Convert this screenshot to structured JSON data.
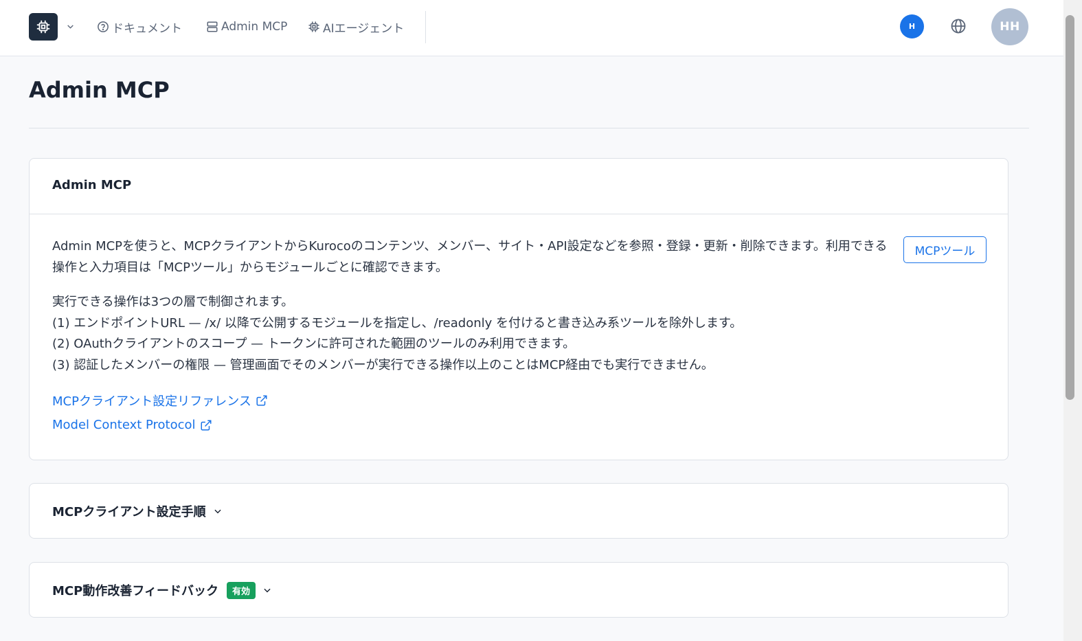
{
  "header": {
    "nav": [
      {
        "label": "ドキュメント",
        "icon": "help-circle-icon"
      },
      {
        "label": "Admin MCP",
        "icon": "server-icon"
      },
      {
        "label": "AIエージェント",
        "icon": "cpu-icon"
      }
    ],
    "user_initial": "H",
    "avatar_initials": "HH"
  },
  "page": {
    "title": "Admin MCP"
  },
  "intro_card": {
    "heading": "Admin MCP",
    "description": "Admin MCPを使うと、MCPクライアントからKurocoのコンテンツ、メンバー、サイト・API設定などを参照・登録・更新・削除できます。利用できる操作と入力項目は「MCPツール」からモジュールごとに確認できます。",
    "tool_button": "MCPツール",
    "layers": [
      "実行できる操作は3つの層で制御されます。",
      "(1) エンドポイントURL — /x/ 以降で公開するモジュールを指定し、/readonly を付けると書き込み系ツールを除外します。",
      "(2) OAuthクライアントのスコープ — トークンに許可された範囲のツールのみ利用できます。",
      "(3) 認証したメンバーの権限 — 管理画面でそのメンバーが実行できる操作以上のことはMCP経由でも実行できません。"
    ],
    "links": [
      "MCPクライアント設定リファレンス",
      "Model Context Protocol"
    ]
  },
  "sections": {
    "setup": {
      "heading": "MCPクライアント設定手順"
    },
    "feedback": {
      "heading": "MCP動作改善フィードバック",
      "badge": "有効"
    }
  },
  "colors": {
    "accent": "#1a73e8",
    "badge_green": "#17a05d",
    "logo_bg": "#1f2d3f"
  }
}
